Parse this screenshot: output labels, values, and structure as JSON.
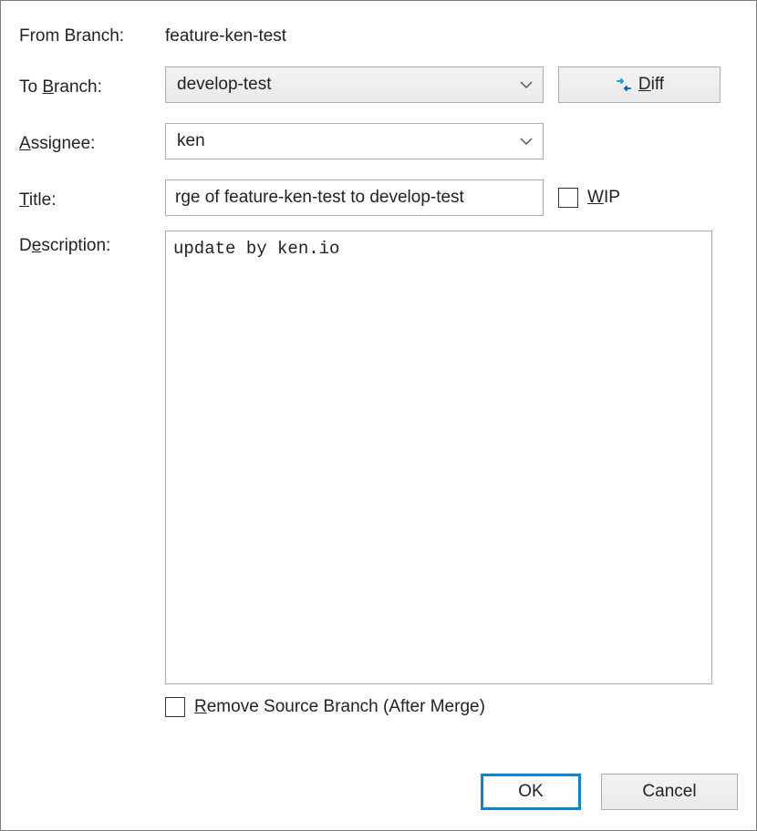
{
  "labels": {
    "from_branch": "From Branch:",
    "to_branch_pre": "To ",
    "to_branch_u": "B",
    "to_branch_post": "ranch:",
    "assignee_u": "A",
    "assignee_post": "ssignee:",
    "title_u": "T",
    "title_post": "itle:",
    "description_pre": "D",
    "description_u": "e",
    "description_post": "scription:",
    "wip_u": "W",
    "wip_post": "IP",
    "remove_u": "R",
    "remove_post": "emove Source Branch (After Merge)",
    "diff_u": "D",
    "diff_post": "iff",
    "ok": "OK",
    "cancel": "Cancel"
  },
  "values": {
    "from_branch": "feature-ken-test",
    "to_branch": "develop-test",
    "assignee": "ken",
    "title": "rge of feature-ken-test to develop-test",
    "description": "update by ken.io"
  },
  "state": {
    "wip_checked": false,
    "remove_checked": false
  }
}
